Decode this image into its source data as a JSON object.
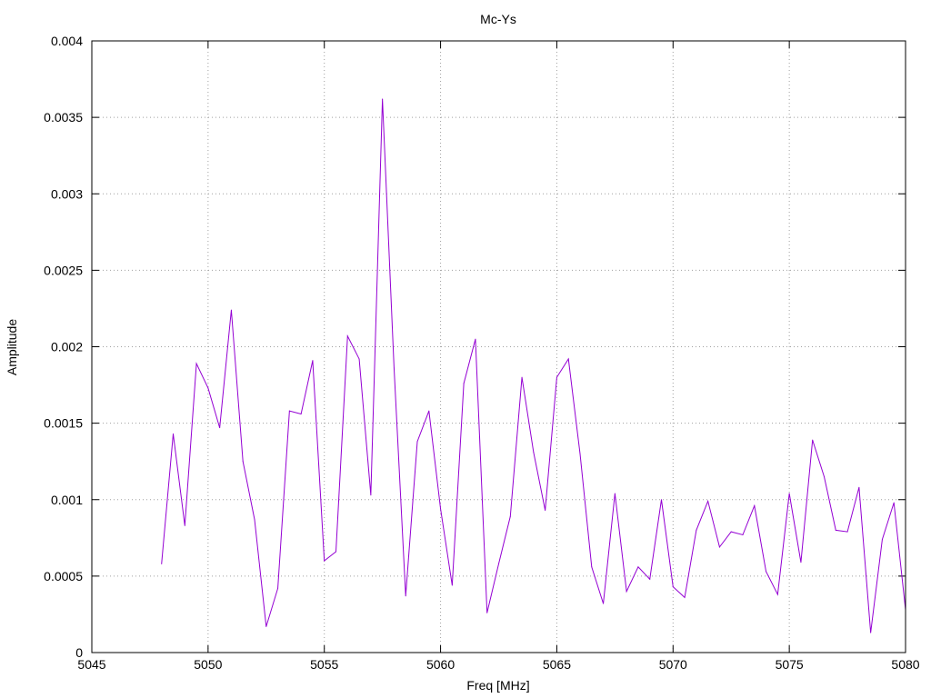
{
  "chart_data": {
    "type": "line",
    "title": "Mc-Ys",
    "xlabel": "Freq [MHz]",
    "ylabel": "Amplitude",
    "xlim": [
      5045,
      5080
    ],
    "ylim": [
      0,
      0.004
    ],
    "grid": true,
    "x_ticks": [
      5045,
      5050,
      5055,
      5060,
      5065,
      5070,
      5075,
      5080
    ],
    "x_tick_labels": [
      "5045",
      "5050",
      "5055",
      "5060",
      "5065",
      "5070",
      "5075",
      "5080"
    ],
    "y_ticks": [
      0,
      0.0005,
      0.001,
      0.0015,
      0.002,
      0.0025,
      0.003,
      0.0035,
      0.004
    ],
    "y_tick_labels": [
      "0",
      "0.0005",
      "0.001",
      "0.0015",
      "0.002",
      "0.0025",
      "0.003",
      "0.0035",
      "0.004"
    ],
    "series_color": "#9400d3",
    "series": [
      {
        "x": [
          5048.0,
          5048.5,
          5049.0,
          5049.5,
          5050.0,
          5050.5,
          5051.0,
          5051.5,
          5052.0,
          5052.5,
          5053.0,
          5053.5,
          5054.0,
          5054.5,
          5055.0,
          5055.5,
          5056.0,
          5056.5,
          5057.0,
          5057.5,
          5058.0,
          5058.5,
          5059.0,
          5059.5,
          5060.0,
          5060.5,
          5061.0,
          5061.5,
          5062.0,
          5062.5,
          5063.0,
          5063.5,
          5064.0,
          5064.5,
          5065.0,
          5065.5,
          5066.0,
          5066.5,
          5067.0,
          5067.5,
          5068.0,
          5068.5,
          5069.0,
          5069.5,
          5070.0,
          5070.5,
          5071.0,
          5071.5,
          5072.0,
          5072.5,
          5073.0,
          5073.5,
          5074.0,
          5074.5,
          5075.0,
          5075.5,
          5076.0,
          5076.5,
          5077.0,
          5077.5,
          5078.0,
          5078.5,
          5079.0,
          5079.5,
          5080.0
        ],
        "values": [
          0.00058,
          0.00143,
          0.00083,
          0.00189,
          0.00173,
          0.00147,
          0.00224,
          0.00125,
          0.00087,
          0.00017,
          0.00042,
          0.00158,
          0.00156,
          0.00191,
          0.0006,
          0.00066,
          0.00207,
          0.00192,
          0.00103,
          0.00362,
          0.00186,
          0.00037,
          0.00138,
          0.00158,
          0.00094,
          0.00044,
          0.00176,
          0.00205,
          0.00026,
          0.00058,
          0.00089,
          0.0018,
          0.00131,
          0.00093,
          0.0018,
          0.00192,
          0.0013,
          0.00056,
          0.00032,
          0.00104,
          0.0004,
          0.00056,
          0.00048,
          0.001,
          0.00043,
          0.00036,
          0.0008,
          0.00099,
          0.00069,
          0.00079,
          0.00077,
          0.00096,
          0.00053,
          0.00038,
          0.00104,
          0.00059,
          0.00139,
          0.00115,
          0.0008,
          0.00079,
          0.00108,
          0.00013,
          0.00074,
          0.00098,
          0.00028
        ]
      }
    ]
  }
}
